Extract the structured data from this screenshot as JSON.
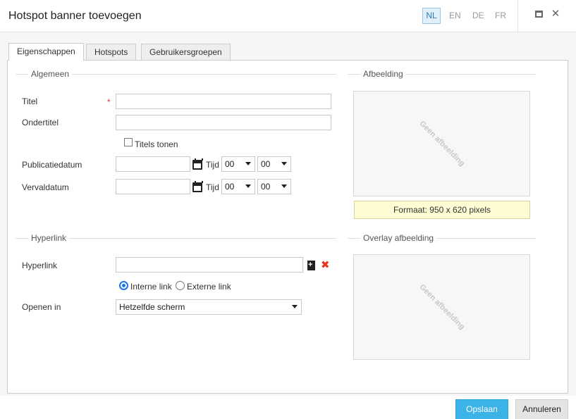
{
  "dialog": {
    "title": "Hotspot banner toevoegen",
    "languages": [
      {
        "code": "NL",
        "active": true
      },
      {
        "code": "EN",
        "active": false
      },
      {
        "code": "DE",
        "active": false
      },
      {
        "code": "FR",
        "active": false
      }
    ],
    "window_controls": {
      "maximize_icon": "maximize-icon",
      "close_icon": "close-icon",
      "close_glyph": "✕"
    }
  },
  "tabs": [
    {
      "label": "Eigenschappen",
      "active": true
    },
    {
      "label": "Hotspots",
      "active": false
    },
    {
      "label": "Gebruikersgroepen",
      "active": false
    }
  ],
  "algemeen": {
    "section_label": "Algemeen",
    "titel_label": "Titel",
    "required_marker": "*",
    "titel_value": "",
    "ondertitel_label": "Ondertitel",
    "ondertitel_value": "",
    "titels_tonen_label": "Titels tonen",
    "titels_tonen_checked": false,
    "publicatiedatum_label": "Publicatiedatum",
    "publicatiedatum_value": "",
    "vervaldatum_label": "Vervaldatum",
    "vervaldatum_value": "",
    "tijd_label": "Tijd",
    "pub_hour": "00",
    "pub_minute": "00",
    "verv_hour": "00",
    "verv_minute": "00"
  },
  "afbeelding": {
    "section_label": "Afbeelding",
    "placeholder": "Geen afbeelding",
    "format_note": "Formaat: 950 x 620 pixels"
  },
  "hyperlink": {
    "section_label": "Hyperlink",
    "hyperlink_label": "Hyperlink",
    "hyperlink_value": "",
    "interne_link_label": "Interne link",
    "externe_link_label": "Externe link",
    "selected_link_type": "Interne link",
    "openen_in_label": "Openen in",
    "openen_in_value": "Hetzelfde scherm",
    "remove_glyph": "✖"
  },
  "overlay": {
    "section_label": "Overlay afbeelding",
    "placeholder": "Geen afbeelding"
  },
  "footer": {
    "save_label": "Opslaan",
    "cancel_label": "Annuleren"
  },
  "colors": {
    "accent": "#3bb3e6",
    "required": "#ee3333",
    "note_bg": "#fdfcd3"
  }
}
